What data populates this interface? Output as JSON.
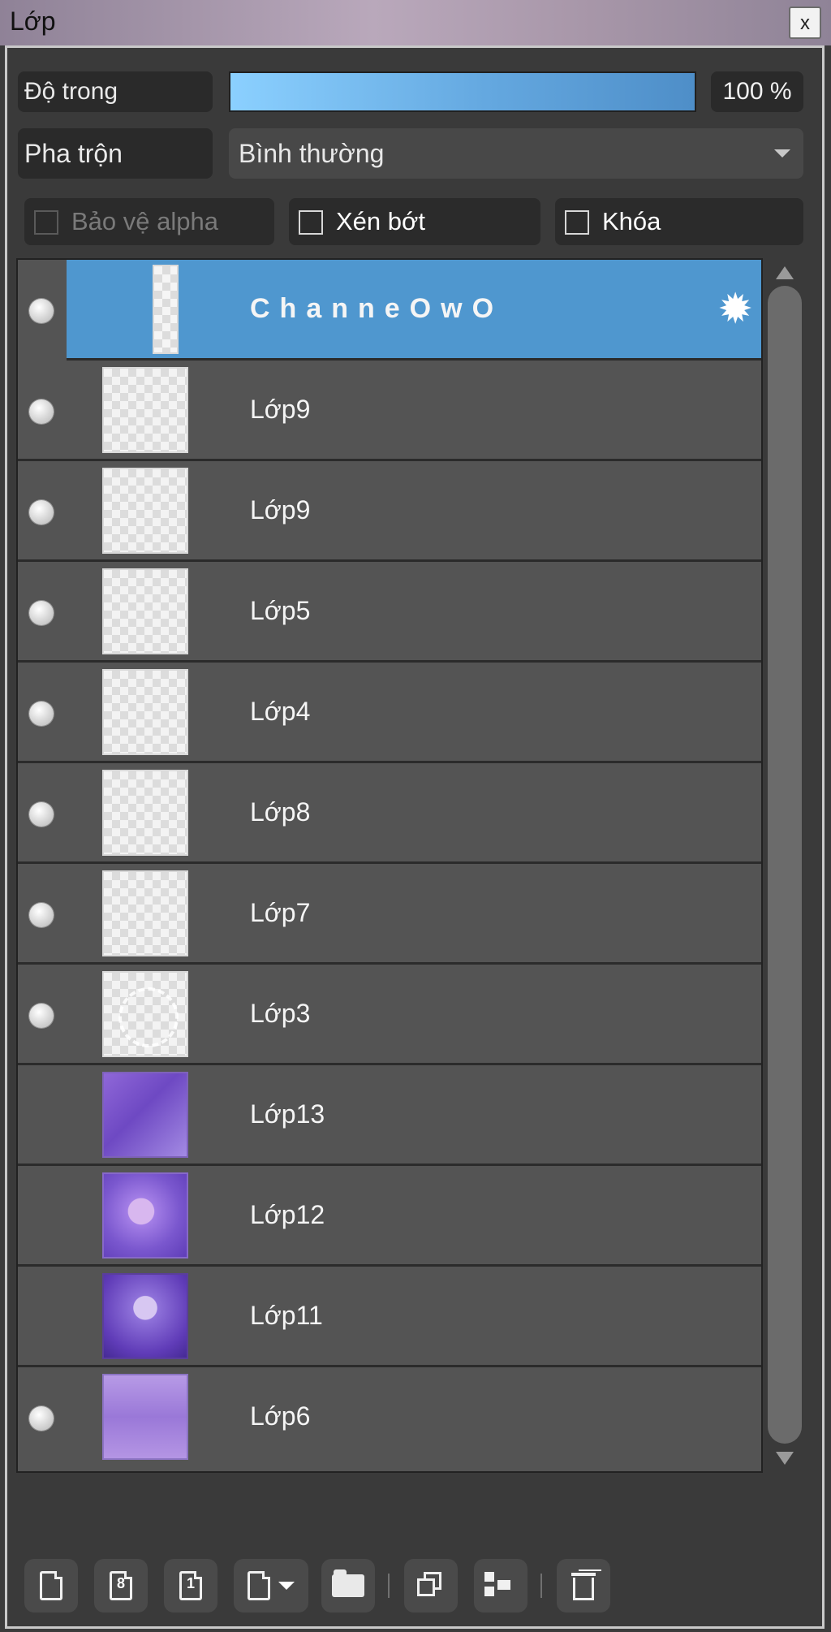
{
  "window": {
    "title": "Lớp",
    "close_label": "x"
  },
  "controls": {
    "opacity_label": "Độ trong",
    "opacity_value": "100 %",
    "opacity_fraction": 1.0,
    "blend_label": "Pha trộn",
    "blend_value": "Bình thường",
    "protect_alpha_label": "Bảo vệ alpha",
    "clip_label": "Xén bớt",
    "lock_label": "Khóa"
  },
  "layers": [
    {
      "name": "ChanneOwO",
      "visible": true,
      "selected": true
    },
    {
      "name": "Lớp9",
      "visible": true
    },
    {
      "name": "Lớp9",
      "visible": true
    },
    {
      "name": "Lớp5",
      "visible": true
    },
    {
      "name": "Lớp4",
      "visible": true
    },
    {
      "name": "Lớp8",
      "visible": true
    },
    {
      "name": "Lớp7",
      "visible": true
    },
    {
      "name": "Lớp3",
      "visible": true
    },
    {
      "name": "Lớp13",
      "visible": false
    },
    {
      "name": "Lớp12",
      "visible": false
    },
    {
      "name": "Lớp11",
      "visible": false
    },
    {
      "name": "Lớp6",
      "visible": true
    }
  ],
  "toolbar": {
    "icon_8": "8",
    "icon_1": "1"
  },
  "colors": {
    "selected_row": "#4f97cf",
    "panel_bg": "#3a3a3a",
    "list_bg": "#545454"
  }
}
